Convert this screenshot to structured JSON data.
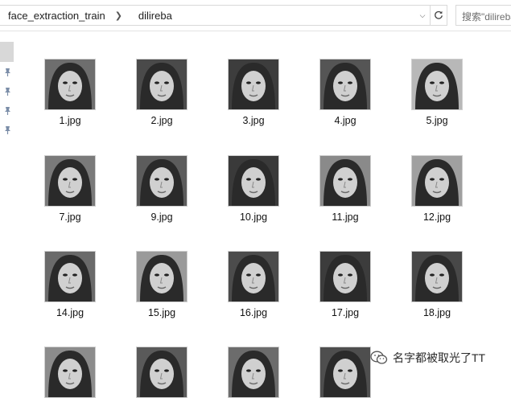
{
  "breadcrumb": [
    "face_extraction_train",
    "dilireba"
  ],
  "search": {
    "placeholder": "搜索\"dilireba\""
  },
  "files": [
    {
      "name": "1.jpg",
      "tone": "#6e6e6e"
    },
    {
      "name": "2.jpg",
      "tone": "#4a4a4a"
    },
    {
      "name": "3.jpg",
      "tone": "#3d3d3d"
    },
    {
      "name": "4.jpg",
      "tone": "#555555"
    },
    {
      "name": "5.jpg",
      "tone": "#b8b8b8"
    },
    {
      "name": "7.jpg",
      "tone": "#7a7a7a"
    },
    {
      "name": "9.jpg",
      "tone": "#5c5c5c"
    },
    {
      "name": "10.jpg",
      "tone": "#3a3a3a"
    },
    {
      "name": "11.jpg",
      "tone": "#8a8a8a"
    },
    {
      "name": "12.jpg",
      "tone": "#a0a0a0"
    },
    {
      "name": "14.jpg",
      "tone": "#6a6a6a"
    },
    {
      "name": "15.jpg",
      "tone": "#9a9a9a"
    },
    {
      "name": "16.jpg",
      "tone": "#4c4c4c"
    },
    {
      "name": "17.jpg",
      "tone": "#3c3c3c"
    },
    {
      "name": "18.jpg",
      "tone": "#484848"
    },
    {
      "name": "",
      "tone": "#8c8c8c"
    },
    {
      "name": "",
      "tone": "#5a5a5a"
    },
    {
      "name": "",
      "tone": "#6c6c6c"
    },
    {
      "name": "",
      "tone": "#4e4e4e"
    }
  ],
  "watermark": {
    "text": "名字都被取光了TT"
  },
  "icons": {
    "separator": "chevron-right-icon",
    "dropdown": "chevron-down-icon",
    "refresh": "refresh-icon",
    "pin": "pin-icon",
    "watermark": "wechat-icon"
  }
}
